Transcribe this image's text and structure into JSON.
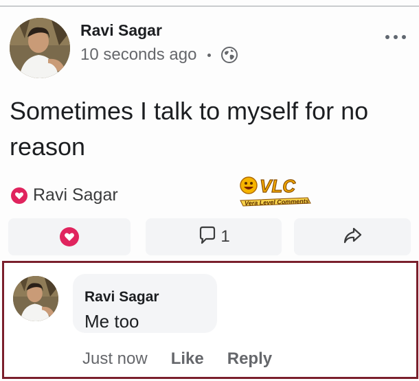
{
  "post": {
    "author": "Ravi Sagar",
    "timestamp": "10 seconds ago",
    "privacy_icon": "globe-icon",
    "text": "Sometimes I talk to myself for no reason",
    "reaction_name": "Ravi Sagar",
    "reaction_type": "heart-icon",
    "comment_count": "1"
  },
  "watermark": {
    "logo_text": "VLC",
    "tagline": "Vera Level Comments"
  },
  "comment": {
    "author": "Ravi Sagar",
    "text": "Me too",
    "time": "Just now",
    "like_label": "Like",
    "reply_label": "Reply"
  },
  "colors": {
    "heart": "#e0245e",
    "highlight_border": "#7a1f2c",
    "secondary_text": "#65676b"
  }
}
